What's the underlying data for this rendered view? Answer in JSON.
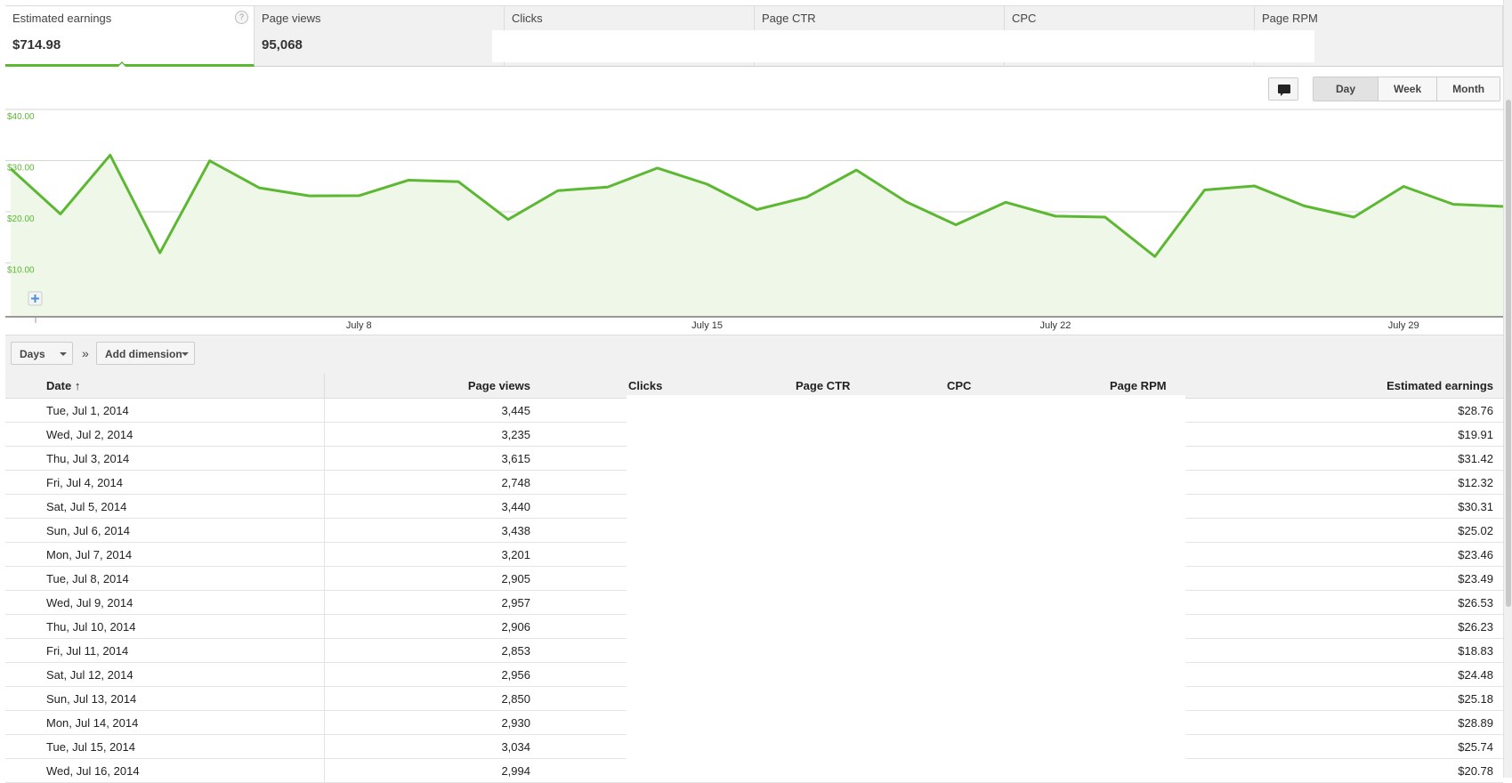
{
  "scorecards": [
    {
      "label": "Estimated earnings",
      "value": "$714.98",
      "active": true
    },
    {
      "label": "Page views",
      "value": "95,068"
    },
    {
      "label": "Clicks",
      "value": ""
    },
    {
      "label": "Page CTR",
      "value": ""
    },
    {
      "label": "CPC",
      "value": ""
    },
    {
      "label": "Page RPM",
      "value": ""
    }
  ],
  "help_glyph": "?",
  "period_buttons": [
    {
      "label": "Day",
      "selected": true
    },
    {
      "label": "Week"
    },
    {
      "label": "Month"
    }
  ],
  "chart_data": {
    "type": "area",
    "series": [
      {
        "name": "Estimated earnings",
        "color": "#5cb832"
      }
    ],
    "x": [
      "Jul 1",
      "Jul 2",
      "Jul 3",
      "Jul 4",
      "Jul 5",
      "Jul 6",
      "Jul 7",
      "Jul 8",
      "Jul 9",
      "Jul 10",
      "Jul 11",
      "Jul 12",
      "Jul 13",
      "Jul 14",
      "Jul 15",
      "Jul 16",
      "Jul 17",
      "Jul 18",
      "Jul 19",
      "Jul 20",
      "Jul 21",
      "Jul 22",
      "Jul 23",
      "Jul 24",
      "Jul 25",
      "Jul 26",
      "Jul 27",
      "Jul 28",
      "Jul 29",
      "Jul 30",
      "Jul 31"
    ],
    "values": [
      28.76,
      19.91,
      31.42,
      12.32,
      30.31,
      25.02,
      23.46,
      23.49,
      26.53,
      26.23,
      18.83,
      24.48,
      25.18,
      28.89,
      25.74,
      20.78,
      23.2,
      28.5,
      22.3,
      17.8,
      22.2,
      19.5,
      19.3,
      11.6,
      24.6,
      25.4,
      21.5,
      19.3,
      25.3,
      21.8,
      21.4
    ],
    "ylim": [
      0,
      40
    ],
    "yticks": [
      "$10.00",
      "$20.00",
      "$30.00",
      "$40.00"
    ],
    "yvals": [
      10,
      20,
      30,
      40
    ],
    "xticks": [
      {
        "label": "July 8",
        "index": 7
      },
      {
        "label": "July 15",
        "index": 14
      },
      {
        "label": "July 22",
        "index": 21
      },
      {
        "label": "July 29",
        "index": 28
      }
    ],
    "grid": true
  },
  "toolbar": {
    "days_label": "Days",
    "separator": "»",
    "add_dimension_label": "Add dimension"
  },
  "table": {
    "headers": {
      "date": "Date",
      "page_views": "Page views",
      "clicks": "Clicks",
      "page_ctr": "Page CTR",
      "cpc": "CPC",
      "page_rpm": "Page RPM",
      "earnings": "Estimated earnings"
    },
    "rows": [
      {
        "date": "Tue, Jul 1, 2014",
        "page_views": "3,445",
        "earnings": "$28.76"
      },
      {
        "date": "Wed, Jul 2, 2014",
        "page_views": "3,235",
        "earnings": "$19.91"
      },
      {
        "date": "Thu, Jul 3, 2014",
        "page_views": "3,615",
        "earnings": "$31.42"
      },
      {
        "date": "Fri, Jul 4, 2014",
        "page_views": "2,748",
        "earnings": "$12.32"
      },
      {
        "date": "Sat, Jul 5, 2014",
        "page_views": "3,440",
        "earnings": "$30.31"
      },
      {
        "date": "Sun, Jul 6, 2014",
        "page_views": "3,438",
        "earnings": "$25.02"
      },
      {
        "date": "Mon, Jul 7, 2014",
        "page_views": "3,201",
        "earnings": "$23.46"
      },
      {
        "date": "Tue, Jul 8, 2014",
        "page_views": "2,905",
        "earnings": "$23.49"
      },
      {
        "date": "Wed, Jul 9, 2014",
        "page_views": "2,957",
        "earnings": "$26.53"
      },
      {
        "date": "Thu, Jul 10, 2014",
        "page_views": "2,906",
        "earnings": "$26.23"
      },
      {
        "date": "Fri, Jul 11, 2014",
        "page_views": "2,853",
        "earnings": "$18.83"
      },
      {
        "date": "Sat, Jul 12, 2014",
        "page_views": "2,956",
        "earnings": "$24.48"
      },
      {
        "date": "Sun, Jul 13, 2014",
        "page_views": "2,850",
        "earnings": "$25.18"
      },
      {
        "date": "Mon, Jul 14, 2014",
        "page_views": "2,930",
        "earnings": "$28.89"
      },
      {
        "date": "Tue, Jul 15, 2014",
        "page_views": "3,034",
        "earnings": "$25.74"
      },
      {
        "date": "Wed, Jul 16, 2014",
        "page_views": "2,994",
        "earnings": "$20.78"
      }
    ]
  }
}
